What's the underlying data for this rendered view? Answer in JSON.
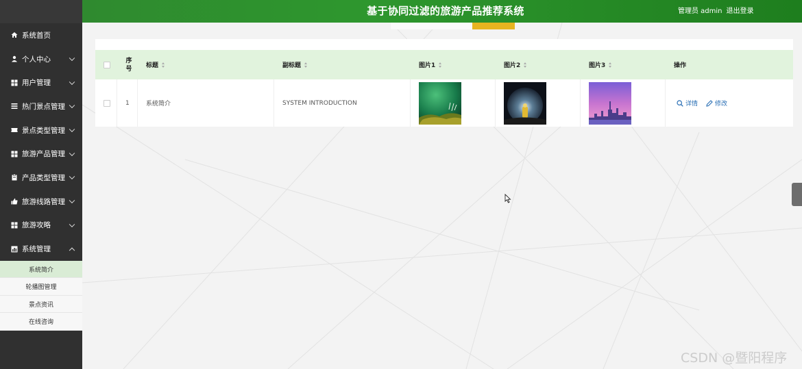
{
  "header": {
    "title": "基于协同过滤的旅游产品推荐系统",
    "role_user": "管理员 admin",
    "logout": "退出登录"
  },
  "sidebar": {
    "items": [
      {
        "label": "系统首页",
        "icon": "home-icon"
      },
      {
        "label": "个人中心",
        "icon": "user-icon"
      },
      {
        "label": "用户管理",
        "icon": "grid-icon"
      },
      {
        "label": "热门景点管理",
        "icon": "list-icon"
      },
      {
        "label": "景点类型管理",
        "icon": "ticket-icon"
      },
      {
        "label": "旅游产品管理",
        "icon": "grid-icon"
      },
      {
        "label": "产品类型管理",
        "icon": "clipboard-icon"
      },
      {
        "label": "旅游线路管理",
        "icon": "thumb-icon"
      },
      {
        "label": "旅游攻略",
        "icon": "grid-icon"
      },
      {
        "label": "系统管理",
        "icon": "chart-icon"
      }
    ],
    "submenu": [
      {
        "label": "系统简介",
        "active": true
      },
      {
        "label": "轮播图管理"
      },
      {
        "label": "景点资讯"
      },
      {
        "label": "在线咨询"
      }
    ]
  },
  "table": {
    "headers": {
      "index": "序号",
      "title": "标题",
      "subtitle": "副标题",
      "pic1": "图片1",
      "pic2": "图片2",
      "pic3": "图片3",
      "ops": "操作"
    },
    "rows": [
      {
        "index": "1",
        "title": "系统简介",
        "subtitle": "SYSTEM INTRODUCTION",
        "pic1": "green-nature-image",
        "pic2": "space-astronaut-image",
        "pic3": "purple-city-skyline-image"
      }
    ],
    "actions": {
      "detail": "详情",
      "edit": "修改"
    }
  },
  "watermark": "CSDN @暨阳程序",
  "colors": {
    "header_green": "#2e972e",
    "accent_yellow": "#e7b420",
    "sidebar_dark": "#303030",
    "table_head": "#e1f3dd",
    "link_blue": "#2a6fb5"
  }
}
